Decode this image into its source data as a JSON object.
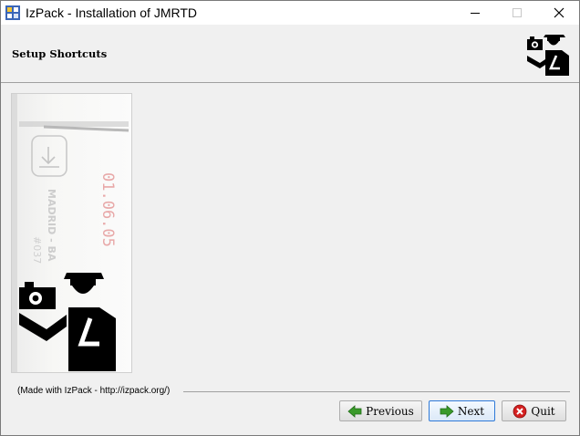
{
  "window": {
    "title": "IzPack - Installation of JMRTD",
    "controls": {
      "minimize": "minimize",
      "maximize": "maximize",
      "close": "close"
    }
  },
  "header": {
    "title": "Setup Shortcuts",
    "logo_icon": "izpack-border-guard-icon"
  },
  "side_panel": {
    "image": "passport-stamp-izpack-logo",
    "stamp_text": [
      "01.06.05",
      "MADRID - BA",
      "#037"
    ]
  },
  "footer": {
    "made_with": "(Made with IzPack - http://izpack.org/)",
    "buttons": {
      "previous": "Previous",
      "next": "Next",
      "quit": "Quit"
    }
  },
  "colors": {
    "background": "#f0f0f0",
    "previous_icon": "#3a9a2a",
    "next_icon": "#3a9a2a",
    "quit_icon": "#d42020",
    "focus_border": "#2f7ad8"
  }
}
